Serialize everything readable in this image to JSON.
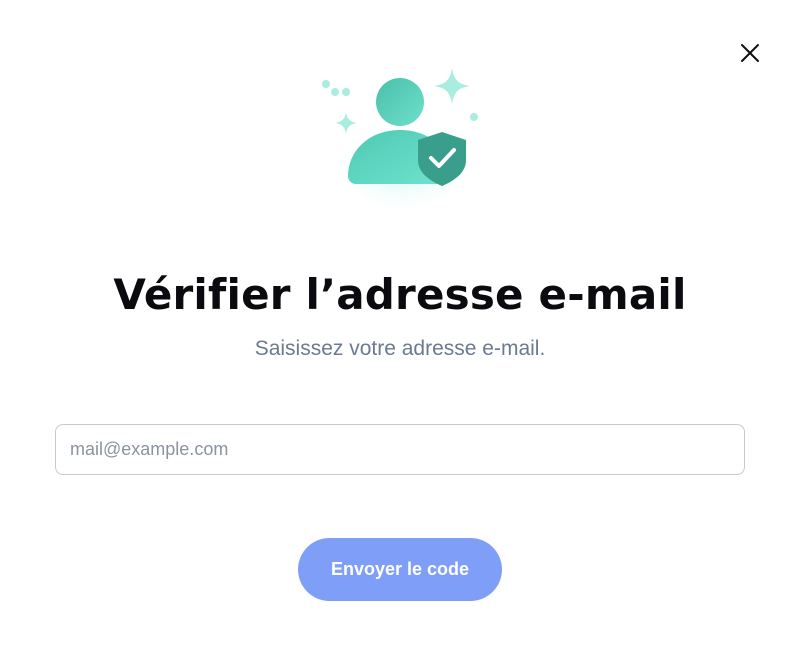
{
  "dialog": {
    "title": "Vérifier l’adresse e-mail",
    "subtitle": "Saisissez votre adresse e-mail.",
    "close_icon": "close-icon",
    "illustration_icon": "user-verified-shield-icon"
  },
  "form": {
    "email": {
      "value": "",
      "placeholder": "mail@example.com"
    },
    "submit_label": "Envoyer le code"
  },
  "colors": {
    "accent": "#7f9ef8",
    "illustration_teal": "#4fd1b9",
    "title": "#0b0b0f",
    "subtitle": "#6b7a90"
  }
}
